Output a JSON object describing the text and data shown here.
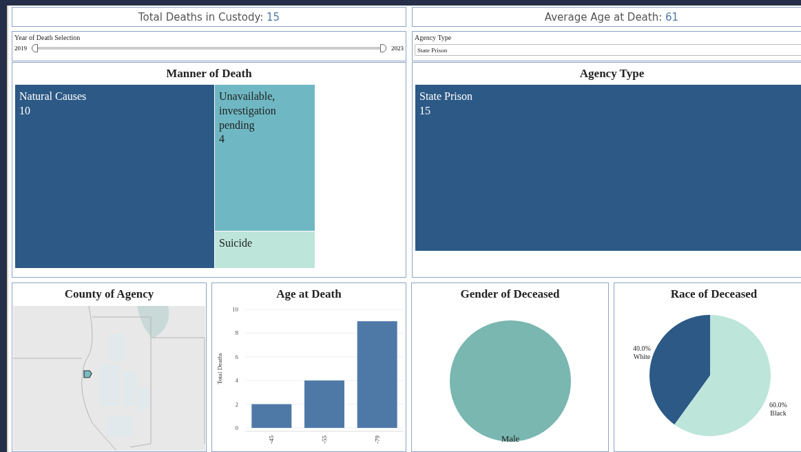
{
  "kpis": [
    {
      "label": "Total Deaths in Custody:",
      "value": "15"
    },
    {
      "label": "Average Age at Death:",
      "value": "61"
    }
  ],
  "year_filter": {
    "label": "Year of Death Selection",
    "min_label": "2019",
    "max_label": "2023",
    "thumbs": [
      {
        "level": 0
      },
      {
        "level": 1
      }
    ]
  },
  "agency_filter": {
    "label": "Agency Type",
    "value": "State Prison"
  },
  "manner_of_death": {
    "title": "Manner of Death",
    "items": [
      {
        "label": "Natural Causes",
        "value": "10",
        "color": "#2c5985"
      },
      {
        "label": "Unavailable, investigation pending",
        "value": "4",
        "color": "#6fb8c3"
      },
      {
        "label": "Suicide",
        "color": "#bde5da"
      }
    ]
  },
  "agency_type": {
    "title": "Agency Type",
    "items": [
      {
        "label": "State Prison",
        "value": "15",
        "color": "#2c5985"
      }
    ]
  },
  "county_of_agency": {
    "title": "County of Agency"
  },
  "age_at_death": {
    "title": "Age at Death",
    "chart_data": {
      "type": "bar",
      "ylabel": "Total Deaths",
      "categories": [
        "-45",
        "-55",
        "-79"
      ],
      "values": [
        2,
        4,
        9
      ],
      "ylim": [
        0,
        10
      ],
      "yticks": [
        0,
        2,
        4,
        6,
        8,
        10
      ],
      "grid": true
    }
  },
  "gender": {
    "title": "Gender of Deceased",
    "chart_data": {
      "type": "pie",
      "categories": [
        "Male"
      ],
      "values": [
        100
      ],
      "colors": [
        "#79b7b0"
      ]
    }
  },
  "race": {
    "title": "Race of Deceased",
    "chart_data": {
      "type": "pie",
      "categories": [
        "White",
        "Black"
      ],
      "values": [
        40,
        60
      ],
      "colors": [
        "#2c5985",
        "#bde5da"
      ],
      "value_labels": [
        "40.0%",
        "60.0%"
      ]
    }
  }
}
